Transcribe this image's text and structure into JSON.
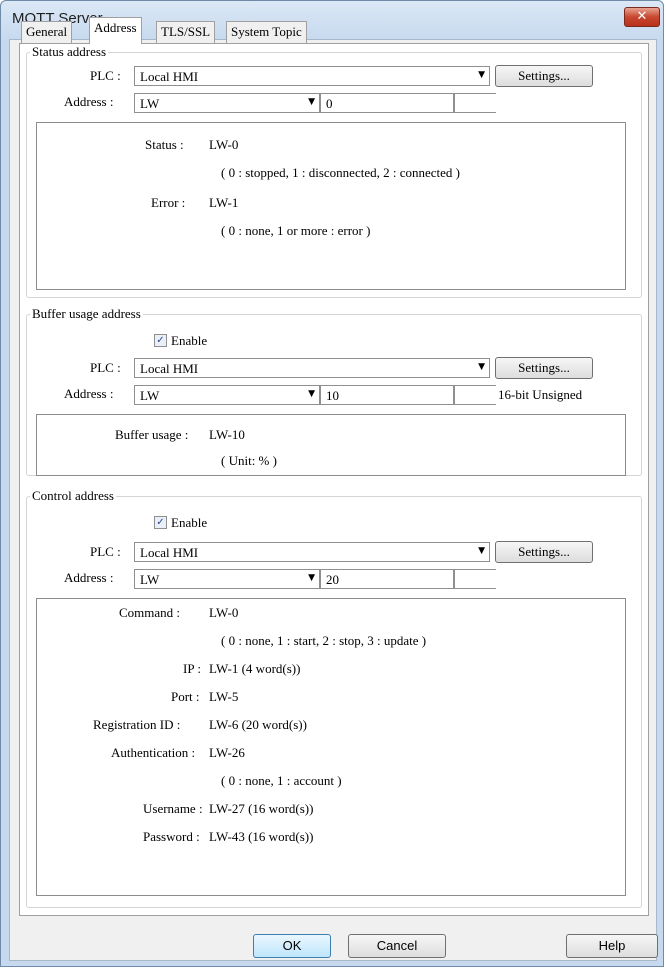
{
  "window": {
    "title": "MQTT Server",
    "close_glyph": "✕"
  },
  "tabs": [
    "General",
    "Address",
    "TLS/SSL",
    "System Topic"
  ],
  "status": {
    "legend": "Status address",
    "plc_label": "PLC :",
    "plc_value": "Local HMI",
    "settings_label": "Settings...",
    "address_label": "Address :",
    "address_type": "LW",
    "address_value": "0",
    "info": [
      {
        "label": "Status :",
        "value": "LW-0"
      },
      {
        "label": "",
        "value": "( 0 : stopped, 1 : disconnected, 2 : connected )"
      },
      {
        "label": "Error :",
        "value": "LW-1"
      },
      {
        "label": "",
        "value": "( 0 : none, 1 or more : error )"
      }
    ]
  },
  "buffer": {
    "legend": "Buffer usage address",
    "enable_label": "Enable",
    "enabled": true,
    "plc_label": "PLC :",
    "plc_value": "Local HMI",
    "settings_label": "Settings...",
    "address_label": "Address :",
    "address_type": "LW",
    "address_value": "10",
    "data_type": "16-bit Unsigned",
    "info": [
      {
        "label": "Buffer usage :",
        "value": "LW-10"
      },
      {
        "label": "",
        "value": "( Unit: % )"
      }
    ]
  },
  "control": {
    "legend": "Control address",
    "enable_label": "Enable",
    "enabled": true,
    "plc_label": "PLC :",
    "plc_value": "Local HMI",
    "settings_label": "Settings...",
    "address_label": "Address :",
    "address_type": "LW",
    "address_value": "20",
    "info": [
      {
        "label": "Command :",
        "value": "LW-0"
      },
      {
        "label": "",
        "value": "( 0 : none, 1 : start, 2 : stop, 3 : update )"
      },
      {
        "label": "IP :",
        "value": "LW-1 (4 word(s))"
      },
      {
        "label": "Port :",
        "value": "LW-5"
      },
      {
        "label": "Registration ID :",
        "value": "LW-6 (20 word(s))"
      },
      {
        "label": "Authentication :",
        "value": "LW-26"
      },
      {
        "label": "",
        "value": "( 0 : none, 1 : account )"
      },
      {
        "label": "Username :",
        "value": "LW-27 (16 word(s))"
      },
      {
        "label": "Password :",
        "value": "LW-43 (16 word(s))"
      }
    ]
  },
  "footer": {
    "ok": "OK",
    "cancel": "Cancel",
    "help": "Help"
  }
}
